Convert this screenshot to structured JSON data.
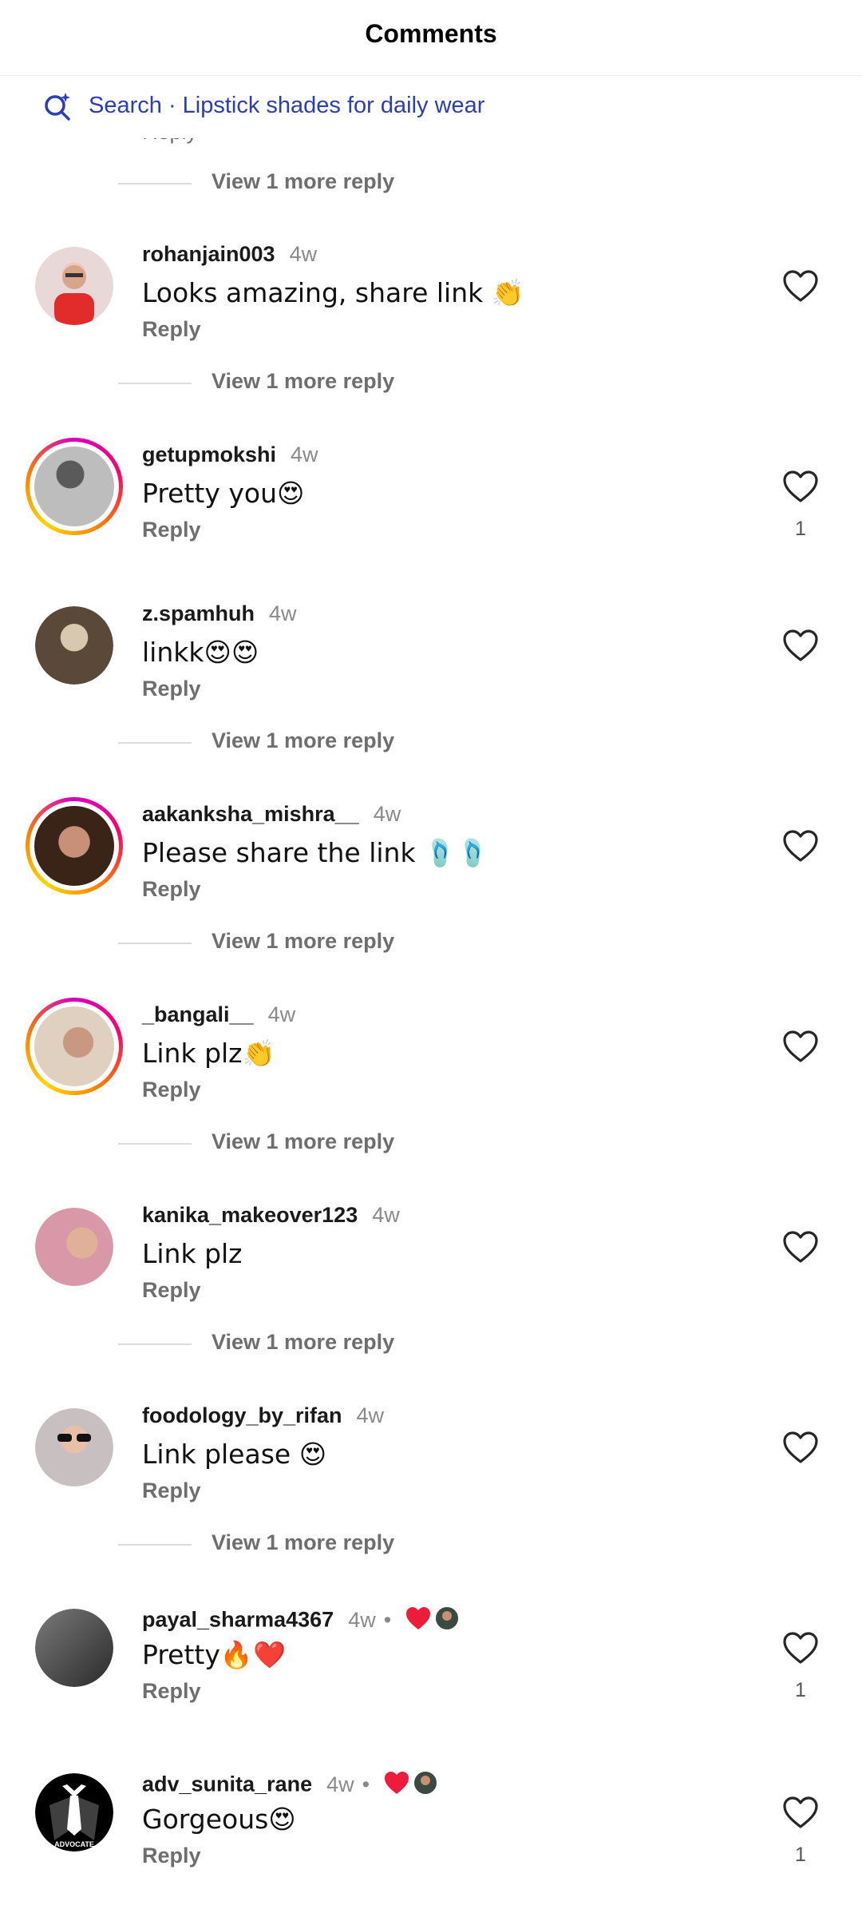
{
  "header": {
    "title": "Comments"
  },
  "search": {
    "text": "Search · Lipstick shades for daily wear"
  },
  "view_more_label": "View 1 more reply",
  "reply_label": "Reply",
  "comments": [
    {
      "username": "rohanjain003",
      "time": "4w",
      "text": "Looks amazing, share link 👏",
      "likes": "",
      "story": false,
      "avatar_color": "#e8d4d4"
    },
    {
      "username": "getupmokshi",
      "time": "4w",
      "text": "Pretty you😍",
      "likes": "1",
      "story": true,
      "avatar_color": "#8c8c8c"
    },
    {
      "username": "z.spamhuh",
      "time": "4w",
      "text": "linkk😍😍",
      "likes": "",
      "story": false,
      "avatar_color": "#6b5845"
    },
    {
      "username": "aakanksha_mishra__",
      "time": "4w",
      "text": "Please share the link 🩴🩴",
      "likes": "",
      "story": true,
      "avatar_color": "#7a4a3a"
    },
    {
      "username": "_bangali__",
      "time": "4w",
      "text": "Link plz👏",
      "likes": "",
      "story": true,
      "avatar_color": "#c8a890"
    },
    {
      "username": "kanika_makeover123",
      "time": "4w",
      "text": "Link plz",
      "likes": "",
      "story": false,
      "avatar_color": "#d8a8b0"
    },
    {
      "username": "foodology_by_rifan",
      "time": "4w",
      "text": "Link please 😍",
      "likes": "",
      "story": false,
      "avatar_color": "#b8a8a8"
    },
    {
      "username": "payal_sharma4367",
      "time": "4w",
      "text": "Pretty🔥❤️",
      "likes": "1",
      "story": false,
      "avatar_color": "#4a4a4a",
      "creator_liked": true
    },
    {
      "username": "adv_sunita_rane",
      "time": "4w",
      "text": "Gorgeous😍",
      "likes": "1",
      "story": false,
      "avatar_color": "#000000",
      "creator_liked": true,
      "avatar_label": "ADVOCATE"
    }
  ],
  "colors": {
    "accent": "#2c3db8",
    "heart": "#ed1c3b"
  }
}
